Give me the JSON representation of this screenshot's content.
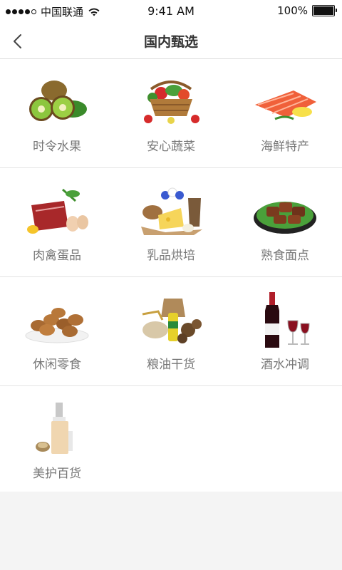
{
  "status_bar": {
    "carrier": "中国联通",
    "time": "9:41 AM",
    "battery": "100%",
    "battery_level": 1.0
  },
  "nav": {
    "title": "国内甄选",
    "back_icon": "chevron-left-icon"
  },
  "categories": [
    {
      "label": "时令水果",
      "icon": "kiwi-fruit-image"
    },
    {
      "label": "安心蔬菜",
      "icon": "vegetable-basket-image"
    },
    {
      "label": "海鲜特产",
      "icon": "salmon-image"
    },
    {
      "label": "肉禽蛋品",
      "icon": "meat-eggs-image"
    },
    {
      "label": "乳品烘培",
      "icon": "dairy-cheese-image"
    },
    {
      "label": "熟食面点",
      "icon": "cooked-meat-plate-image"
    },
    {
      "label": "休闲零食",
      "icon": "pecan-nuts-image"
    },
    {
      "label": "粮油干货",
      "icon": "grain-oil-image"
    },
    {
      "label": "酒水冲调",
      "icon": "red-wine-image"
    },
    {
      "label": "美护百货",
      "icon": "cosmetics-bottle-image"
    }
  ],
  "colors": {
    "background": "#f4f4f4",
    "card": "#ffffff",
    "label": "#777777",
    "title": "#333333"
  }
}
